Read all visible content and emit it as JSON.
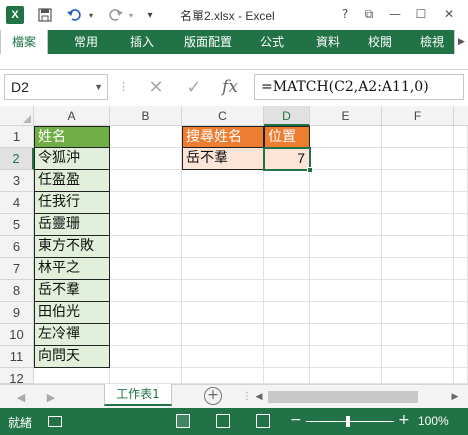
{
  "title": "名單2.xlsx - Excel",
  "window": {
    "help": "?",
    "restore": "⧉",
    "minimize": "—",
    "maximize": "☐",
    "close": "✕"
  },
  "ribbon": {
    "tabs": [
      {
        "label": "檔案",
        "active": true
      },
      {
        "label": "常用"
      },
      {
        "label": "插入"
      },
      {
        "label": "版面配置"
      },
      {
        "label": "公式"
      },
      {
        "label": "資料"
      },
      {
        "label": "校閱"
      },
      {
        "label": "檢視"
      }
    ]
  },
  "formula_bar": {
    "name_box": "D2",
    "formula": "=MATCH(C2,A2:A11,0)",
    "cancel": "✕",
    "enter": "✓",
    "fx": "fx"
  },
  "columns": [
    "A",
    "B",
    "C",
    "D",
    "E",
    "F"
  ],
  "rows": [
    "1",
    "2",
    "3",
    "4",
    "5",
    "6",
    "7",
    "8",
    "9",
    "10",
    "11",
    "12"
  ],
  "cells": {
    "A1": "姓名",
    "A2": "令狐沖",
    "A3": "任盈盈",
    "A4": "任我行",
    "A5": "岳靈珊",
    "A6": "東方不敗",
    "A7": "林平之",
    "A8": "岳不羣",
    "A9": "田伯光",
    "A10": "左冷禪",
    "A11": "向問天",
    "C1": "搜尋姓名",
    "C2": "岳不羣",
    "D1": "位置",
    "D2": "7"
  },
  "sheet_tabs": {
    "active": "工作表1",
    "add": "+"
  },
  "status": {
    "text": "就緒",
    "zoom": "100%",
    "zoom_minus": "−",
    "zoom_plus": "+"
  },
  "colors": {
    "accent": "#217346",
    "header_green": "#70ad47",
    "header_orange": "#ed7d31",
    "data_green": "#e2efda",
    "data_orange": "#fce4d6"
  }
}
